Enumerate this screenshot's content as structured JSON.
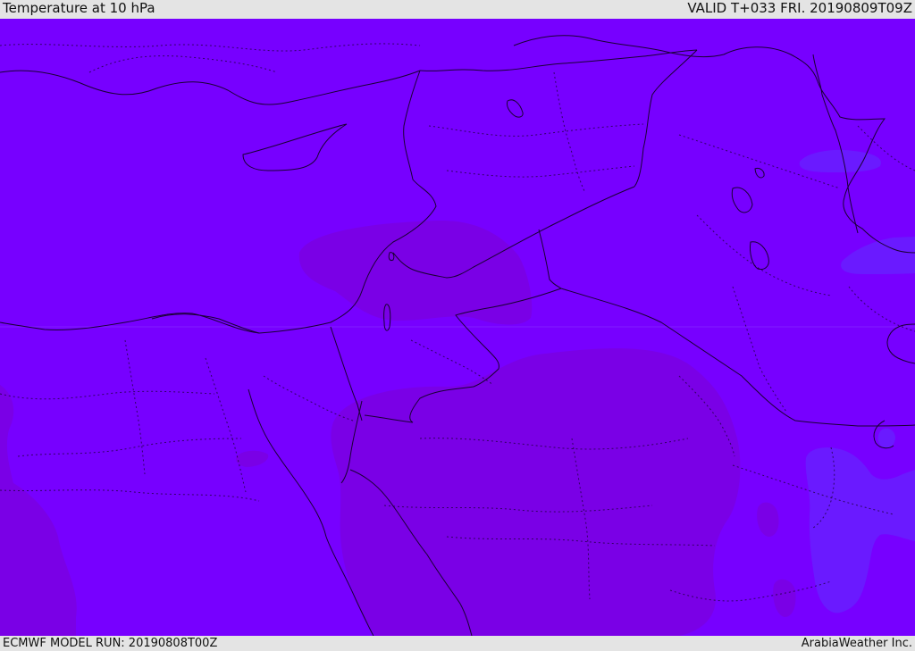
{
  "header": {
    "title": "Temperature at 10 hPa",
    "valid": "VALID T+033 FRI. 20190809T09Z"
  },
  "footer": {
    "model_run": "ECMWF MODEL RUN: 20190808T00Z",
    "credit": "ArabiaWeather Inc."
  },
  "map": {
    "colors": {
      "base_field": "#7700ff",
      "warmer_field": "#7a00e6",
      "cooler_field": "#6a1aff",
      "coastline": "#1a0033",
      "border": "#1a0033"
    }
  }
}
